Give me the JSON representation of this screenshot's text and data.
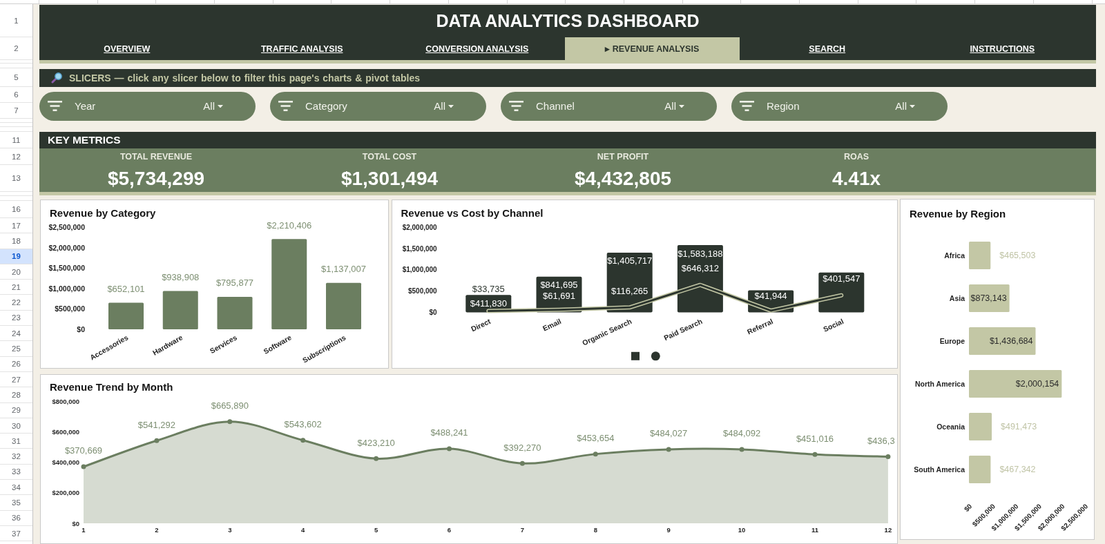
{
  "title": "DATA ANALYTICS DASHBOARD",
  "nav_tabs": [
    {
      "label": "OVERVIEW",
      "selected": false
    },
    {
      "label": "TRAFFIC ANALYSIS",
      "selected": false
    },
    {
      "label": "CONVERSION ANALYSIS",
      "selected": false
    },
    {
      "label": "▸ REVENUE ANALYSIS",
      "selected": true
    },
    {
      "label": "SEARCH",
      "selected": false
    },
    {
      "label": "INSTRUCTIONS",
      "selected": false
    }
  ],
  "slicer_banner": {
    "text": "SLICERS — click any slicer below to filter this page's charts & pivot tables"
  },
  "slicers": [
    {
      "label": "Year",
      "value": "All"
    },
    {
      "label": "Category",
      "value": "All"
    },
    {
      "label": "Channel",
      "value": "All"
    },
    {
      "label": "Region",
      "value": "All"
    }
  ],
  "key_metrics": {
    "heading": "KEY METRICS",
    "items": [
      {
        "label": "TOTAL REVENUE",
        "value": "$5,734,299"
      },
      {
        "label": "TOTAL COST",
        "value": "$1,301,494"
      },
      {
        "label": "NET PROFIT",
        "value": "$4,432,805"
      },
      {
        "label": "ROAS",
        "value": "4.41x"
      }
    ]
  },
  "charts": [
    {
      "chart_data": {
        "type": "bar",
        "title": "Revenue by Category",
        "categories": [
          "Accessories",
          "Hardware",
          "Services",
          "Software",
          "Subscriptions"
        ],
        "values": [
          652101,
          938908,
          795877,
          2210406,
          1137007
        ],
        "ylim": [
          0,
          2500000
        ],
        "yticks": [
          {
            "value": 0,
            "label": "$0"
          },
          {
            "value": 500000,
            "label": "$500,000"
          },
          {
            "value": 1000000,
            "label": "$1,000,000"
          },
          {
            "value": 1500000,
            "label": "$1,500,000"
          },
          {
            "value": 2000000,
            "label": "$2,000,000"
          },
          {
            "value": 2500000,
            "label": "$2,500,000"
          }
        ],
        "value_labels": [
          "$652,101",
          "$938,908",
          "$795,877",
          "$2,210,406",
          "$1,137,007"
        ]
      }
    },
    {
      "chart_data": {
        "type": "bar",
        "title": "Revenue vs Cost by Channel",
        "categories": [
          "Direct",
          "Email",
          "Organic Search",
          "Paid Search",
          "Referral",
          "Social"
        ],
        "series": [
          {
            "type": "bar",
            "color": "#2c352e",
            "values": [
              411830,
              841695,
              1405717,
              1583188,
              520000,
              940000
            ],
            "value_labels": [
              "$411,830",
              "$841,695",
              "$1,405,717",
              "$1,583,188",
              null,
              null
            ]
          },
          {
            "type": "line",
            "color": "#2c352e",
            "values": [
              33735,
              61691,
              116265,
              646312,
              41944,
              401547
            ],
            "value_labels": [
              "$33,735",
              "$61,691",
              "$116,265",
              "$646,312",
              "$41,944",
              "$401,547"
            ]
          }
        ],
        "ylim": [
          0,
          2000000
        ],
        "yticks": [
          {
            "value": 0,
            "label": "$0"
          },
          {
            "value": 500000,
            "label": "$500,000"
          },
          {
            "value": 1000000,
            "label": "$1,000,000"
          },
          {
            "value": 1500000,
            "label": "$1,500,000"
          },
          {
            "value": 2000000,
            "label": "$2,000,000"
          }
        ]
      }
    },
    {
      "chart_data": {
        "type": "bar",
        "orientation": "horizontal",
        "title": "Revenue by Region",
        "categories": [
          "Africa",
          "Asia",
          "Europe",
          "North America",
          "Oceania",
          "South America"
        ],
        "values": [
          465503,
          873143,
          1436684,
          2000154,
          491473,
          467342
        ],
        "xlim": [
          0,
          2500000
        ],
        "xticks": [
          {
            "value": 0,
            "label": "$0"
          },
          {
            "value": 500000,
            "label": "$500,000"
          },
          {
            "value": 1000000,
            "label": "$1,000,000"
          },
          {
            "value": 1500000,
            "label": "$1,500,000"
          },
          {
            "value": 2000000,
            "label": "$2,000,000"
          },
          {
            "value": 2500000,
            "label": "$2,500,000"
          }
        ],
        "value_labels": [
          "$465,503",
          "$873,143",
          "$1,436,684",
          "$2,000,154",
          "$491,473",
          "$467,342"
        ]
      }
    },
    {
      "chart_data": {
        "type": "area",
        "title": "Revenue Trend by Month",
        "x": [
          1,
          2,
          3,
          4,
          5,
          6,
          7,
          8,
          9,
          10,
          11,
          12
        ],
        "values": [
          370669,
          541292,
          665890,
          543602,
          423210,
          488241,
          392270,
          453654,
          484027,
          484092,
          451016,
          436300
        ],
        "xlim": [
          1,
          12
        ],
        "ylim": [
          0,
          800000
        ],
        "yticks": [
          {
            "value": 0,
            "label": "$0"
          },
          {
            "value": 200000,
            "label": "$200,000"
          },
          {
            "value": 400000,
            "label": "$400,000"
          },
          {
            "value": 600000,
            "label": "$600,000"
          },
          {
            "value": 800000,
            "label": "$800,000"
          }
        ],
        "xticks": [
          1,
          2,
          3,
          4,
          5,
          6,
          7,
          8,
          9,
          10,
          11,
          12
        ],
        "value_labels": [
          "$370,669",
          "$541,292",
          "$665,890",
          "$543,602",
          "$423,210",
          "$488,241",
          "$392,270",
          "$453,654",
          "$484,027",
          "$484,092",
          "$451,016",
          null
        ],
        "annotations": [
          "$436,3"
        ]
      }
    }
  ],
  "row_headers": [
    {
      "label": "1",
      "selected": false
    },
    {
      "label": "2",
      "selected": false
    },
    {
      "label": "5",
      "selected": false
    },
    {
      "label": "6",
      "selected": false
    },
    {
      "label": "7",
      "selected": false
    },
    {
      "label": "11",
      "selected": false
    },
    {
      "label": "12",
      "selected": false
    },
    {
      "label": "13",
      "selected": false
    },
    {
      "label": "16",
      "selected": false
    },
    {
      "label": "17",
      "selected": false
    },
    {
      "label": "18",
      "selected": false
    },
    {
      "label": "19",
      "selected": true
    },
    {
      "label": "20",
      "selected": false
    },
    {
      "label": "21",
      "selected": false
    },
    {
      "label": "22",
      "selected": false
    },
    {
      "label": "23",
      "selected": false
    },
    {
      "label": "24",
      "selected": false
    },
    {
      "label": "25",
      "selected": false
    },
    {
      "label": "26",
      "selected": false
    },
    {
      "label": "27",
      "selected": false
    },
    {
      "label": "28",
      "selected": false
    },
    {
      "label": "29",
      "selected": false
    },
    {
      "label": "30",
      "selected": false
    },
    {
      "label": "31",
      "selected": false
    },
    {
      "label": "32",
      "selected": false
    },
    {
      "label": "33",
      "selected": false
    },
    {
      "label": "34",
      "selected": false
    },
    {
      "label": "35",
      "selected": false
    },
    {
      "label": "36",
      "selected": false
    },
    {
      "label": "37",
      "selected": false
    }
  ]
}
